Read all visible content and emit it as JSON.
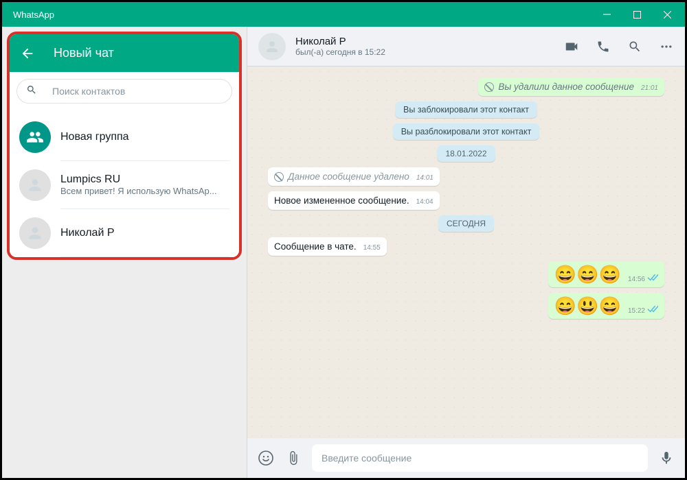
{
  "titlebar": {
    "title": "WhatsApp"
  },
  "sidebar": {
    "new_chat_title": "Новый чат",
    "search_placeholder": "Поиск контактов",
    "new_group_label": "Новая группа",
    "contacts": [
      {
        "name": "Lumpics RU",
        "status": "Всем привет! Я использую WhatsAp..."
      },
      {
        "name": "Николай Р",
        "status": ""
      }
    ]
  },
  "chat": {
    "header": {
      "name": "Николай Р",
      "status": "был(-а) сегодня в 15:22"
    },
    "messages": {
      "m0": {
        "text": "Вы удалили данное сообщение",
        "time": "21:01"
      },
      "m1": {
        "text": "Вы заблокировали этот контакт"
      },
      "m2": {
        "text": "Вы разблокировали этот контакт"
      },
      "m3": {
        "text": "18.01.2022"
      },
      "m4": {
        "text": "Данное сообщение удалено",
        "time": "14:01"
      },
      "m5": {
        "text": "Новое измененное сообщение.",
        "time": "14:04"
      },
      "m6": {
        "text": "СЕГОДНЯ"
      },
      "m7": {
        "text": "Сообщение в чате.",
        "time": "14:55"
      },
      "m8": {
        "text": "😄😄😄",
        "time": "14:56"
      },
      "m9": {
        "text": "😄😃😄",
        "time": "15:22"
      }
    },
    "input_placeholder": "Введите сообщение"
  }
}
